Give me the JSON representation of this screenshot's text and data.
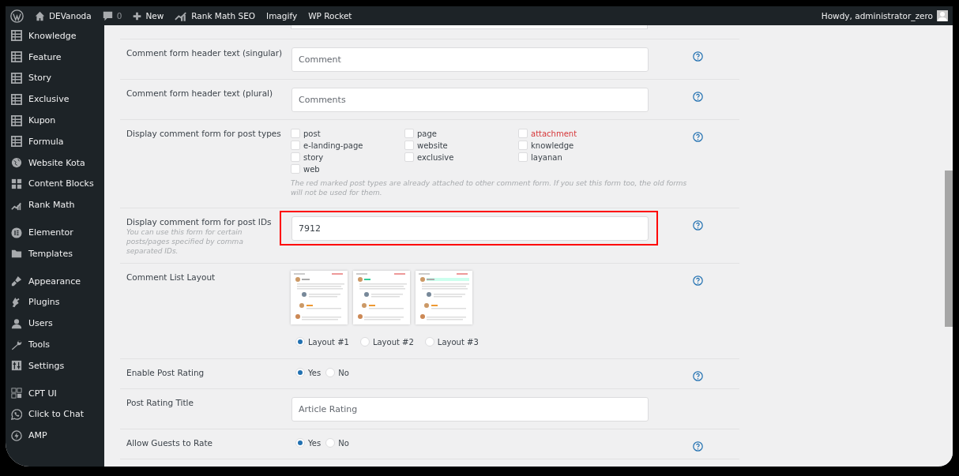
{
  "admin_bar": {
    "items": [
      {
        "kind": "home",
        "label": "DEVanoda"
      },
      {
        "kind": "comments",
        "label": "0"
      },
      {
        "kind": "new",
        "label": "New"
      },
      {
        "kind": "rank",
        "label": "Rank Math SEO"
      },
      {
        "kind": "text",
        "label": "Imagify"
      },
      {
        "kind": "text",
        "label": "WP Rocket"
      }
    ],
    "greeting": "Howdy, administrator_zero"
  },
  "sidebar": {
    "groups": [
      {
        "items": [
          "Knowledge",
          "Feature",
          "Story",
          "Exclusive",
          "Kupon",
          "Formula",
          "Website Kota",
          "Content Blocks",
          "Rank Math"
        ]
      },
      {
        "items": [
          "Elementor",
          "Templates"
        ]
      },
      {
        "items": [
          "Appearance",
          "Plugins",
          "Users",
          "Tools",
          "Settings"
        ]
      },
      {
        "items": [
          "CPT UI",
          "Click to Chat",
          "AMP"
        ]
      }
    ]
  },
  "settings": {
    "rows": [
      {
        "kind": "text",
        "label": "Comment form header text (singular)",
        "placeholder": "Comment",
        "help": true
      },
      {
        "kind": "text",
        "label": "Comment form header text (plural)",
        "placeholder": "Comments",
        "help": true
      },
      {
        "kind": "checkboxes",
        "label": "Display comment form for post types",
        "help": true,
        "note": "The red marked post types are already attached to other comment form. If you set this form too, the old forms will not be used for them.",
        "options": [
          {
            "label": "post",
            "checked": false,
            "marked": false
          },
          {
            "label": "page",
            "checked": false,
            "marked": false
          },
          {
            "label": "attachment",
            "checked": false,
            "marked": true
          },
          {
            "label": "e-landing-page",
            "checked": false,
            "marked": false
          },
          {
            "label": "website",
            "checked": false,
            "marked": false
          },
          {
            "label": "knowledge",
            "checked": false,
            "marked": false
          },
          {
            "label": "story",
            "checked": false,
            "marked": false
          },
          {
            "label": "exclusive",
            "checked": false,
            "marked": false
          },
          {
            "label": "layanan",
            "checked": false,
            "marked": false
          },
          {
            "label": "web",
            "checked": false,
            "marked": false
          }
        ]
      },
      {
        "kind": "text",
        "label": "Display comment form for post IDs",
        "hint": "You can use this form for certain posts/pages specified by comma separated IDs.",
        "value": "7912",
        "highlighted": true,
        "help": true
      },
      {
        "kind": "layouts",
        "label": "Comment List Layout",
        "help": true,
        "options": [
          {
            "label": "Layout #1",
            "selected": true
          },
          {
            "label": "Layout #2",
            "selected": false
          },
          {
            "label": "Layout #3",
            "selected": false
          }
        ]
      },
      {
        "kind": "radios",
        "label": "Enable Post Rating",
        "help": true,
        "options": [
          {
            "label": "Yes",
            "selected": true
          },
          {
            "label": "No",
            "selected": false
          }
        ]
      },
      {
        "kind": "text",
        "label": "Post Rating Title",
        "placeholder": "Article Rating",
        "help": false
      },
      {
        "kind": "radios",
        "label": "Allow Guests to Rate",
        "help": true,
        "options": [
          {
            "label": "Yes",
            "selected": true
          },
          {
            "label": "No",
            "selected": false
          }
        ]
      }
    ]
  }
}
